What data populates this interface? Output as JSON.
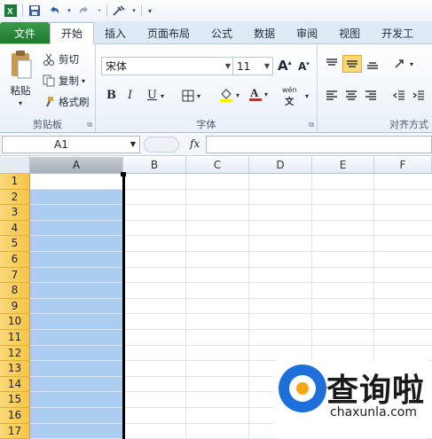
{
  "qat": {
    "app_icon": "excel-icon",
    "save": "save-icon",
    "undo": "undo-icon",
    "redo": "redo-icon",
    "tool": "tools-icon"
  },
  "tabs": [
    {
      "label": "文件"
    },
    {
      "label": "开始"
    },
    {
      "label": "插入"
    },
    {
      "label": "页面布局"
    },
    {
      "label": "公式"
    },
    {
      "label": "数据"
    },
    {
      "label": "审阅"
    },
    {
      "label": "视图"
    },
    {
      "label": "开发工"
    }
  ],
  "clipboard": {
    "paste": "粘贴",
    "cut": "剪切",
    "copy": "复制",
    "format_painter": "格式刷",
    "group_label": "剪贴板"
  },
  "font": {
    "name": "宋体",
    "size": "11",
    "bold": "B",
    "italic": "I",
    "underline": "U",
    "group_label": "字体",
    "grow": "A",
    "shrink": "A",
    "wen": "wén"
  },
  "align": {
    "group_label": "对齐方式"
  },
  "formula_bar": {
    "name_box": "A1",
    "fx": "fx",
    "formula": ""
  },
  "columns": [
    "A",
    "B",
    "C",
    "D",
    "E",
    "F"
  ],
  "rows": [
    "1",
    "2",
    "3",
    "4",
    "5",
    "6",
    "7",
    "8",
    "9",
    "10",
    "11",
    "12",
    "13",
    "14",
    "15",
    "16",
    "17"
  ],
  "watermark": {
    "title": "查询啦",
    "url": "chaxunla.com"
  },
  "colors": {
    "file_tab": "#1e7a2e",
    "selection": "#aacdf0",
    "row_header": "#f5c545",
    "logo": "#1e6fd9"
  }
}
